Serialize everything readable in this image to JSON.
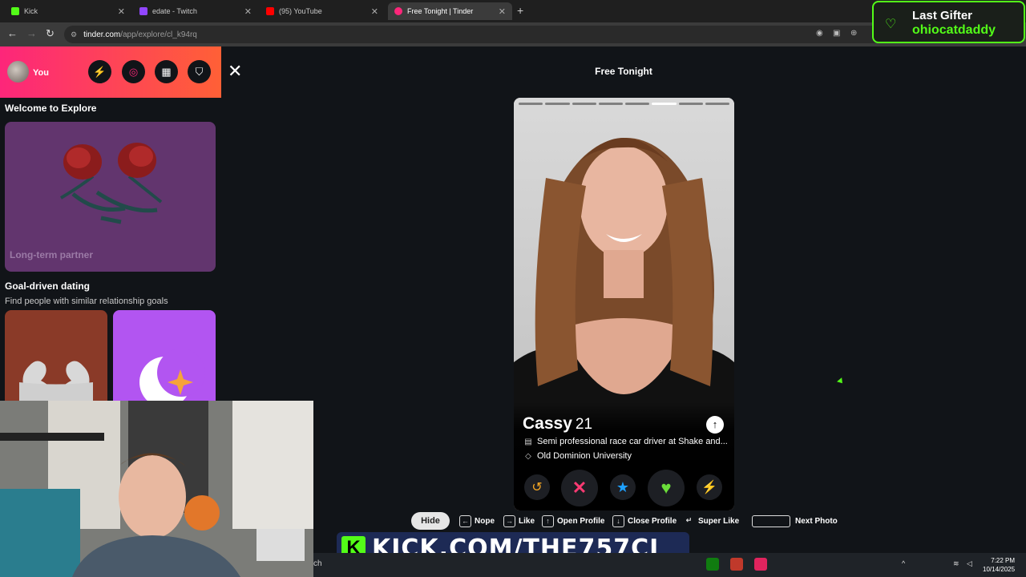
{
  "browser": {
    "tabs": [
      {
        "label": "Kick",
        "icon": "kick-icon",
        "color": "#53fc18"
      },
      {
        "label": "edate - Twitch",
        "icon": "twitch-icon",
        "color": "#9146ff"
      },
      {
        "label": "(95) YouTube",
        "icon": "youtube-icon",
        "color": "#ff0000"
      },
      {
        "label": "Free Tonight | Tinder",
        "icon": "tinder-icon",
        "color": "#fd267a"
      }
    ],
    "url_site": "tinder.com",
    "url_path": "/app/explore/cl_k94rq"
  },
  "gifter": {
    "title": "Last Gifter",
    "name": "ohiocatdaddy"
  },
  "sidebar": {
    "you_label": "You",
    "welcome_title": "Welcome to Explore",
    "longterm_label": "Long-term partner",
    "goal_title": "Goal-driven dating",
    "goal_subtitle": "Find people with similar relationship goals"
  },
  "main": {
    "page_title": "Free Tonight",
    "profile": {
      "name": "Cassy",
      "age": "21",
      "job": "Semi professional race car driver at Shake and...",
      "school": "Old Dominion University",
      "photo_count": 8,
      "active_photo": 6
    }
  },
  "hints": {
    "hide": "Hide",
    "nope": "Nope",
    "like": "Like",
    "open_profile": "Open Profile",
    "close_profile": "Close Profile",
    "super_like": "Super Like",
    "next_photo": "Next Photo"
  },
  "kick_banner": {
    "k": "K",
    "text": "KICK.COM/THE757CJ"
  },
  "taskbar": {
    "search": "ch",
    "time": "7:22 PM",
    "date": "10/14/2025"
  },
  "colors": {
    "tinder_gradient_start": "#fd267a",
    "tinder_gradient_end": "#ff6036",
    "kick_green": "#53fc18"
  }
}
